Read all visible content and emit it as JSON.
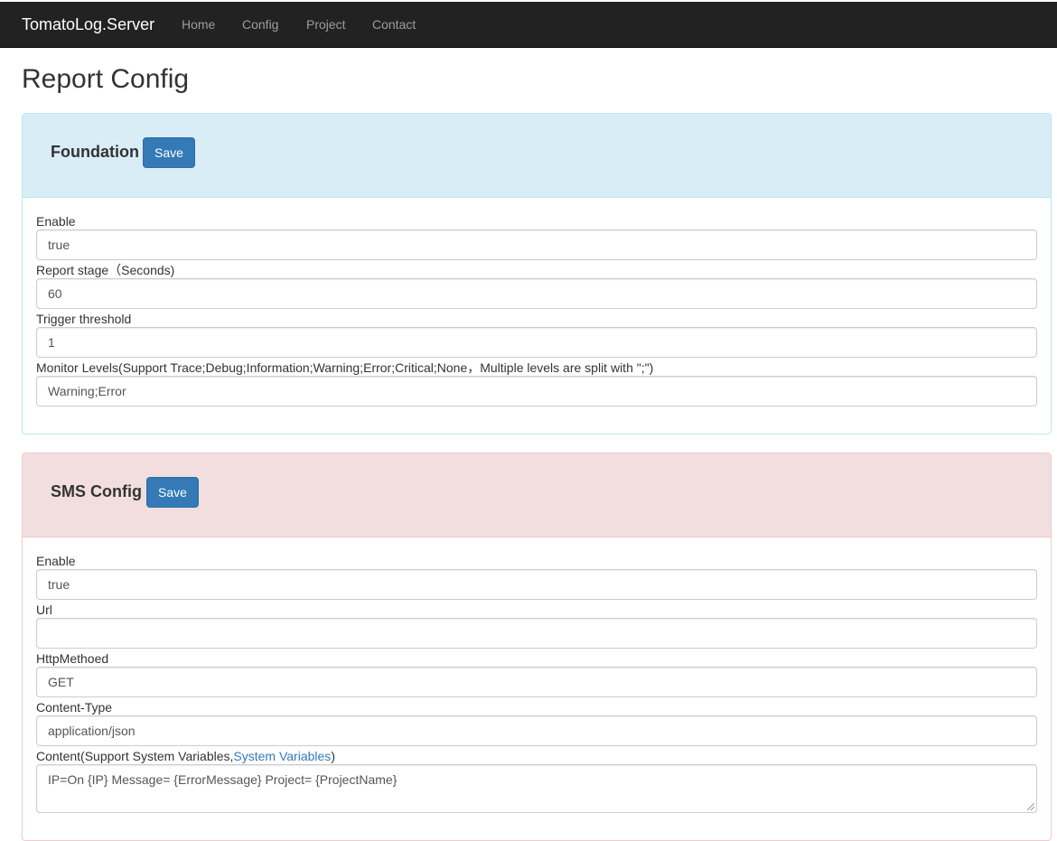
{
  "navbar": {
    "brand": "TomatoLog.Server",
    "links": [
      "Home",
      "Config",
      "Project",
      "Contact"
    ]
  },
  "page": {
    "title": "Report Config"
  },
  "foundation": {
    "title": "Foundation",
    "save_label": "Save",
    "fields": [
      {
        "label": "Enable",
        "value": "true"
      },
      {
        "label": "Report stage（Seconds)",
        "value": "60"
      },
      {
        "label": "Trigger threshold",
        "value": "1"
      },
      {
        "label": "Monitor Levels(Support Trace;Debug;Information;Warning;Error;Critical;None，Multiple levels are split with \";\")",
        "value": "Warning;Error"
      }
    ]
  },
  "sms": {
    "title": "SMS Config",
    "save_label": "Save",
    "fields": [
      {
        "label": "Enable",
        "value": "true"
      },
      {
        "label": "Url",
        "value": ""
      },
      {
        "label": "HttpMethoed",
        "value": "GET"
      },
      {
        "label": "Content-Type",
        "value": "application/json"
      }
    ],
    "content": {
      "label_prefix": "Content(Support System Variables,",
      "link": "System Variables",
      "label_suffix": ")",
      "value": "IP=On {IP} Message= {ErrorMessage} Project= {ProjectName}"
    }
  },
  "colors": {
    "navbar_bg": "#222222",
    "info_heading": "#d9edf7",
    "danger_heading": "#f2dede",
    "primary_button": "#337ab7",
    "link": "#337ab7"
  }
}
